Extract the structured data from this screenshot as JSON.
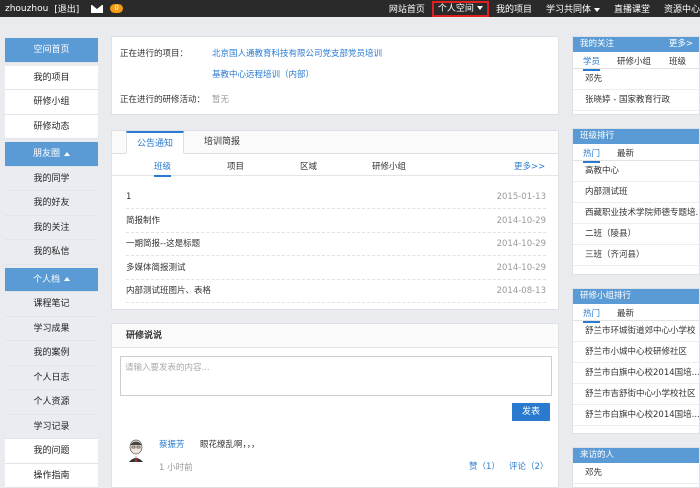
{
  "topbar": {
    "username": "zhouzhou",
    "logout": "[退出]",
    "mail_count": "0",
    "nav": [
      "网站首页",
      "个人空间",
      "我的项目",
      "学习共同体",
      "直播课堂",
      "资源中心"
    ]
  },
  "sidebar": [
    {
      "label": "空间首页",
      "style": "hl"
    },
    {
      "label": "我的项目",
      "style": "white"
    },
    {
      "label": "研修小组",
      "style": "white"
    },
    {
      "label": "研修动态",
      "style": "white"
    },
    {
      "label": "朋友圈",
      "style": "hl",
      "caret": true
    },
    {
      "label": "我的同学",
      "style": "grey"
    },
    {
      "label": "我的好友",
      "style": "grey"
    },
    {
      "label": "我的关注",
      "style": "grey"
    },
    {
      "label": "我的私信",
      "style": "grey"
    },
    {
      "label": "个人档",
      "style": "hl",
      "caret": true
    },
    {
      "label": "课程笔记",
      "style": "grey"
    },
    {
      "label": "学习成果",
      "style": "grey"
    },
    {
      "label": "我的案例",
      "style": "grey"
    },
    {
      "label": "个人日志",
      "style": "grey"
    },
    {
      "label": "个人资源",
      "style": "grey"
    },
    {
      "label": "学习记录",
      "style": "grey"
    },
    {
      "label": "我的问题",
      "style": "white"
    },
    {
      "label": "操作指南",
      "style": "white"
    }
  ],
  "projects": {
    "label_current": "正在进行的项目：",
    "project1": "北京国人通教育科技有限公司党支部党员培训",
    "project2": "基教中心远程培训（内部）",
    "label_activity": "正在进行的研修活动：",
    "activity": "暂无"
  },
  "notice": {
    "tabs": [
      "公告通知",
      "培训简报"
    ],
    "subtabs": [
      "班级",
      "项目",
      "区域",
      "研修小组"
    ],
    "more": "更多>>",
    "items": [
      {
        "title": "1",
        "date": "2015-01-13"
      },
      {
        "title": "简报制作",
        "date": "2014-10-29"
      },
      {
        "title": "一期简报--这是标题",
        "date": "2014-10-29"
      },
      {
        "title": "多媒体简报测试",
        "date": "2014-10-29"
      },
      {
        "title": "内部测试班图片、表格",
        "date": "2014-08-13"
      }
    ]
  },
  "discuss": {
    "title": "研修说说",
    "placeholder": "请输入要发表的内容...",
    "publish": "发表",
    "post": {
      "author": "蔡振芳",
      "content": "眼花缭乱啊，，，",
      "time": "1 小时前",
      "like": "赞（1）",
      "comment": "评论（2）"
    }
  },
  "right": {
    "follow": {
      "title": "我的关注",
      "more": "更多>",
      "tabs": [
        "学员",
        "研修小组",
        "班级"
      ],
      "items": [
        "邓先",
        "张晓婷 - 国家教育行政"
      ]
    },
    "class_rank": {
      "title": "班级排行",
      "tabs": [
        "热门",
        "最新"
      ],
      "items": [
        "高教中心",
        "内部测试班",
        "西藏职业技术学院师德专题培...",
        "二班（陵县）",
        "三班（齐河县）"
      ]
    },
    "group_rank": {
      "title": "研修小组排行",
      "tabs": [
        "热门",
        "最新"
      ],
      "items": [
        "舒兰市环城街道郊中心小学校",
        "舒兰市小城中心校研修社区",
        "舒兰市白旗中心校2014国培...",
        "舒兰市吉舒街中心小学校社区",
        "舒兰市白旗中心校2014国培..."
      ]
    },
    "visitors": {
      "title": "来访的人",
      "items": [
        "邓先"
      ]
    }
  }
}
